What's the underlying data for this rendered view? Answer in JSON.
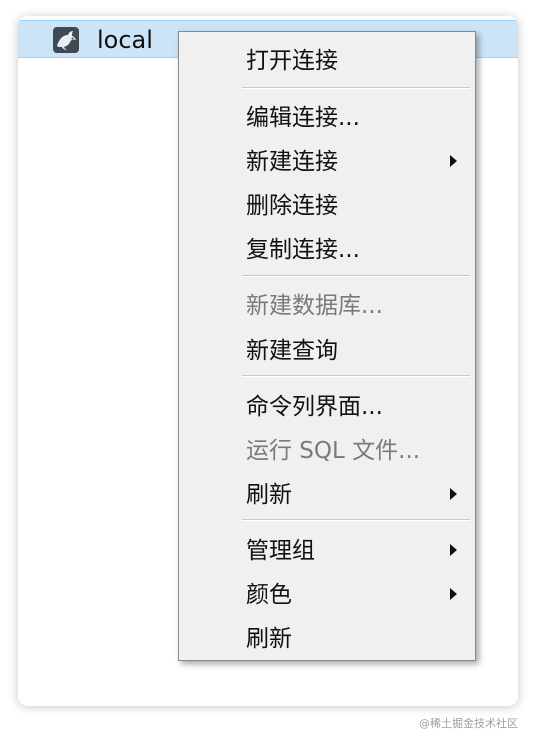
{
  "tree": {
    "connection_name": "local",
    "connection_icon": "mysql-dolphin-icon"
  },
  "context_menu": {
    "items": [
      {
        "label": "打开连接",
        "enabled": true,
        "submenu": false
      },
      {
        "label": "编辑连接...",
        "enabled": true,
        "submenu": false
      },
      {
        "label": "新建连接",
        "enabled": true,
        "submenu": true
      },
      {
        "label": "删除连接",
        "enabled": true,
        "submenu": false
      },
      {
        "label": "复制连接...",
        "enabled": true,
        "submenu": false
      },
      {
        "label": "新建数据库...",
        "enabled": false,
        "submenu": false
      },
      {
        "label": "新建查询",
        "enabled": true,
        "submenu": false
      },
      {
        "label": "命令列界面...",
        "enabled": true,
        "submenu": false
      },
      {
        "label": "运行 SQL 文件...",
        "enabled": false,
        "submenu": false
      },
      {
        "label": "刷新",
        "enabled": true,
        "submenu": true
      },
      {
        "label": "管理组",
        "enabled": true,
        "submenu": true
      },
      {
        "label": "颜色",
        "enabled": true,
        "submenu": true
      },
      {
        "label": "刷新",
        "enabled": true,
        "submenu": false
      }
    ]
  },
  "watermark": "@稀土掘金技术社区",
  "colors": {
    "selection": "#cce4f7",
    "menu_background": "#f0f0f0",
    "disabled_text": "#7a7a7a"
  }
}
